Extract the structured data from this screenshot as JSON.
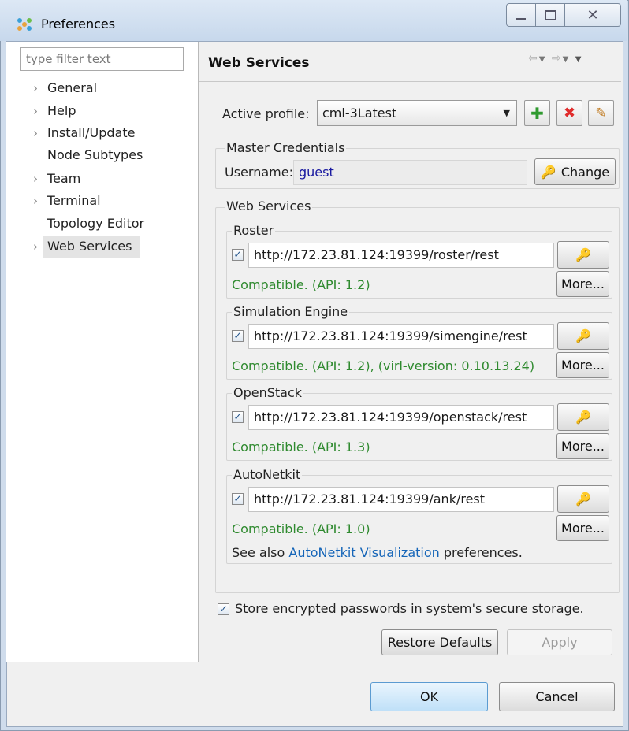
{
  "window": {
    "title": "Preferences"
  },
  "sidebar": {
    "filter_placeholder": "type filter text",
    "items": [
      {
        "label": "General",
        "expandable": true
      },
      {
        "label": "Help",
        "expandable": true
      },
      {
        "label": "Install/Update",
        "expandable": true
      },
      {
        "label": "Node Subtypes",
        "expandable": false
      },
      {
        "label": "Team",
        "expandable": true
      },
      {
        "label": "Terminal",
        "expandable": true
      },
      {
        "label": "Topology Editor",
        "expandable": false
      },
      {
        "label": "Web Services",
        "expandable": true,
        "selected": true
      }
    ]
  },
  "page": {
    "title": "Web Services",
    "active_profile_label": "Active profile:",
    "active_profile_value": "cml-3Latest",
    "master_credentials": {
      "title": "Master Credentials",
      "username_label": "Username:",
      "username_value": "guest",
      "change_label": "Change"
    },
    "web_services": {
      "title": "Web Services",
      "services": [
        {
          "name": "Roster",
          "enabled": true,
          "url": "http://172.23.81.124:19399/roster/rest",
          "status": "Compatible. (API: 1.2)",
          "more": "More..."
        },
        {
          "name": "Simulation Engine",
          "enabled": true,
          "url": "http://172.23.81.124:19399/simengine/rest",
          "status": "Compatible. (API: 1.2), (virl-version: 0.10.13.24)",
          "more": "More..."
        },
        {
          "name": "OpenStack",
          "enabled": true,
          "url": "http://172.23.81.124:19399/openstack/rest",
          "status": "Compatible. (API: 1.3)",
          "more": "More..."
        },
        {
          "name": "AutoNetkit",
          "enabled": true,
          "url": "http://172.23.81.124:19399/ank/rest",
          "status": "Compatible. (API: 1.0)",
          "more": "More..."
        }
      ],
      "see_also_prefix": "See also",
      "see_also_link": "AutoNetkit Visualization",
      "see_also_suffix": "preferences."
    },
    "store_passwords_label": "Store encrypted passwords in system's secure storage.",
    "store_passwords_checked": true,
    "restore_defaults_label": "Restore Defaults",
    "apply_label": "Apply"
  },
  "footer": {
    "ok_label": "OK",
    "cancel_label": "Cancel"
  },
  "colors": {
    "status_ok": "#2f8a2f",
    "link": "#1565b8",
    "username": "#1a1aa0",
    "selection": "#e4e4e4"
  }
}
